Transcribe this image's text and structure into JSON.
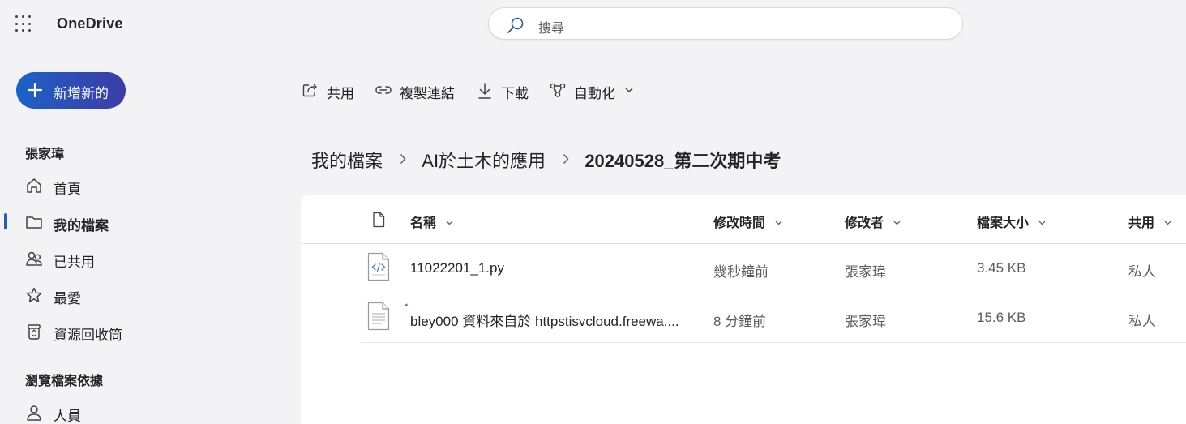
{
  "app": {
    "title": "OneDrive"
  },
  "search": {
    "placeholder": "搜尋"
  },
  "sidebar": {
    "new_button": "新增新的",
    "user_section": "張家瑋",
    "items": [
      {
        "label": "首頁",
        "icon": "home-icon"
      },
      {
        "label": "我的檔案",
        "icon": "folder-icon",
        "active": true
      },
      {
        "label": "已共用",
        "icon": "people-icon"
      },
      {
        "label": "最愛",
        "icon": "star-icon"
      },
      {
        "label": "資源回收筒",
        "icon": "recycle-bin-icon"
      }
    ],
    "browse_section": "瀏覽檔案依據",
    "browse_items": [
      {
        "label": "人員",
        "icon": "person-icon"
      }
    ]
  },
  "toolbar": {
    "share": "共用",
    "copy_link": "複製連結",
    "download": "下載",
    "automate": "自動化"
  },
  "breadcrumb": {
    "items": [
      "我的檔案",
      "AI於土木的應用",
      "20240528_第二次期中考"
    ]
  },
  "table": {
    "columns": {
      "name": "名稱",
      "modified": "修改時間",
      "modified_by": "修改者",
      "size": "檔案大小",
      "sharing": "共用"
    },
    "rows": [
      {
        "name": "11022201_1.py",
        "modified": "幾秒鐘前",
        "modified_by": "張家瑋",
        "size": "3.45 KB",
        "sharing": "私人",
        "icon": "code-file-icon"
      },
      {
        "name": "bley000 資料來自於 httpstisvcloud.freewa....",
        "modified": "8 分鐘前",
        "modified_by": "張家瑋",
        "size": "15.6 KB",
        "sharing": "私人",
        "icon": "text-file-icon"
      }
    ]
  },
  "colors": {
    "accent": "#1f5fbf",
    "new_button_start": "#1b62c9",
    "new_button_end": "#3b3ea6",
    "background": "#f3f3f5"
  }
}
